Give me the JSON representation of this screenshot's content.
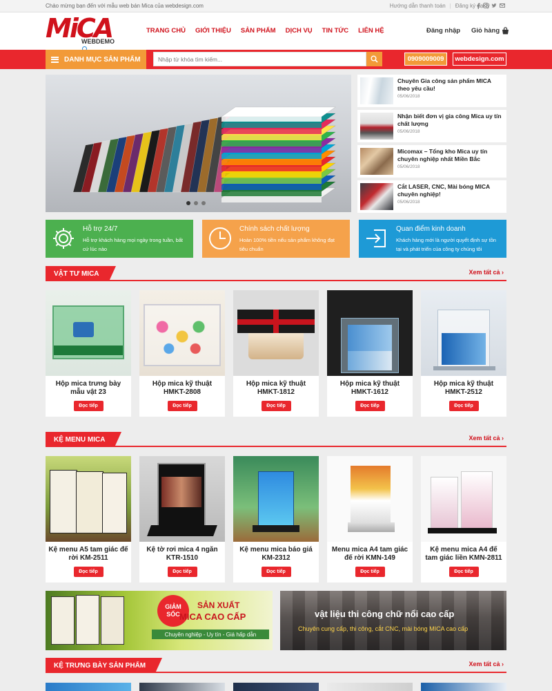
{
  "topbar": {
    "welcome": "Chào mừng bạn đến với mẫu web bán Mica của webdesign.com",
    "payment_guide": "Hướng dẫn thanh toán",
    "agent_register": "Đăng ký đại lý"
  },
  "logo": {
    "main": "MiCA",
    "sub": "WEBDEMO"
  },
  "nav": [
    "TRANG CHỦ",
    "GIỚI THIỆU",
    "SẢN PHẨM",
    "DỊCH VỤ",
    "TIN TỨC",
    "LIÊN HỆ"
  ],
  "header": {
    "login": "Đăng nhập",
    "cart": "Giỏ hàng"
  },
  "category_button": "DANH MỤC SẢN PHẨM",
  "search": {
    "placeholder": "Nhập từ khóa tìm kiếm..."
  },
  "phone": "0909009009",
  "site_button": "webdesign.com",
  "news": [
    {
      "title": "Chuyên Gia công sản phẩm MICA theo yêu cầu!",
      "date": "05/06/2018"
    },
    {
      "title": "Nhận biết đơn vị gia công Mica uy tín chất lượng",
      "date": "05/06/2018"
    },
    {
      "title": "Micomax – Tổng kho Mica uy tín chuyên nghiệp nhất Miền Bắc",
      "date": "05/06/2018"
    },
    {
      "title": "Cắt LASER, CNC, Mài bóng MICA chuyên nghiệp!",
      "date": "05/06/2018"
    }
  ],
  "features": [
    {
      "title": "Hỗ trợ 24/7",
      "desc": "Hỗ trợ khách hàng mọi ngày trong tuần, bất cứ lúc nào",
      "color": "#4cb04f",
      "icon": "gear-icon"
    },
    {
      "title": "Chính sách chất lượng",
      "desc": "Hoàn 100% tiền nếu sản phẩm không đạt tiêu chuẩn",
      "color": "#f5a24b",
      "icon": "clock-icon"
    },
    {
      "title": "Quan điểm kinh doanh",
      "desc": "Khách hàng mới là người quyết định sự tồn tại và phát triển của công ty chúng tôi",
      "color": "#1e9ad6",
      "icon": "login-arrow-icon"
    }
  ],
  "sections": [
    {
      "title": "VẬT TƯ MICA",
      "view_all": "Xem tất cả",
      "products": [
        {
          "name": "Hộp mica trưng bày mẫu vật 23",
          "button": "Đọc tiếp"
        },
        {
          "name": "Hộp mica kỹ thuật HMKT-2808",
          "button": "Đọc tiếp"
        },
        {
          "name": "Hộp mica kỹ thuật HMKT-1812",
          "button": "Đọc tiếp"
        },
        {
          "name": "Hộp mica kỹ thuật HMKT-1612",
          "button": "Đọc tiếp"
        },
        {
          "name": "Hộp mica kỹ thuật HMKT-2512",
          "button": "Đọc tiếp"
        }
      ]
    },
    {
      "title": "KỆ MENU MICA",
      "view_all": "Xem tất cả",
      "products": [
        {
          "name": "Kệ menu A5 tam giác đế rời KM-2511",
          "button": "Đọc tiếp"
        },
        {
          "name": "Kệ tờ rơi mica 4 ngăn KTR-1510",
          "button": "Đọc tiếp"
        },
        {
          "name": "Kệ menu mica báo giá KM-2312",
          "button": "Đọc tiếp"
        },
        {
          "name": "Menu mica A4 tam giác đế rời KMN-149",
          "button": "Đọc tiếp"
        },
        {
          "name": "Kệ menu mica A4 đế tam giác liền KMN-2811",
          "button": "Đọc tiếp"
        }
      ]
    },
    {
      "title": "KỆ TRƯNG BÀY SẢN PHẨM",
      "view_all": "Xem tất cả"
    }
  ],
  "banners": [
    {
      "badge_line1": "GIẢM",
      "badge_line2": "SỐC",
      "headline_1": "SẢN XUẤT",
      "headline_2": "MICA CAO CẤP",
      "tagline": "Chuyên nghiệp - Uy tín - Giá hấp dẫn"
    },
    {
      "headline": "vật liệu thi công chữ nổi cao cấp",
      "tagline": "Chuyên cung cấp, thi công, cắt CNC, mài bóng MICA cao cấp"
    }
  ],
  "colors": {
    "brand_red": "#e9272d",
    "orange": "#f29a38"
  }
}
